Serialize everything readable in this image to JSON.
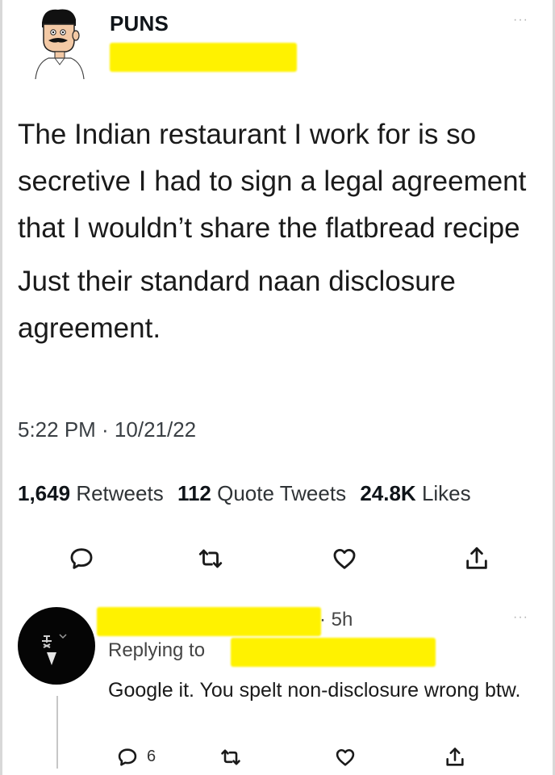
{
  "tweet": {
    "author_name": "PUNS",
    "more_label": "···",
    "body": [
      "The Indian restaurant I work for is so secretive I had to sign a legal agreement that I wouldn’t share the flatbread recipe",
      "Just their standard naan disclosure agreement."
    ],
    "timestamp": "5:22 PM · 10/21/22",
    "stats": {
      "retweets_count": "1,649",
      "retweets_label": "Retweets",
      "quotes_count": "112",
      "quotes_label": "Quote Tweets",
      "likes_count": "24.8K",
      "likes_label": "Likes"
    },
    "actions": [
      "reply-icon",
      "retweet-icon",
      "like-icon",
      "share-icon"
    ]
  },
  "reply": {
    "time": "· 5h",
    "more_label": "···",
    "replying_to_label": "Replying to",
    "text": "Google it. You spelt non-disclosure wrong btw.",
    "reply_count": "6",
    "actions": [
      "reply-icon",
      "retweet-icon",
      "like-icon",
      "share-icon"
    ]
  },
  "colors": {
    "redaction": "#fff200",
    "text": "#0f1419",
    "icon": "#1a1a1a"
  }
}
